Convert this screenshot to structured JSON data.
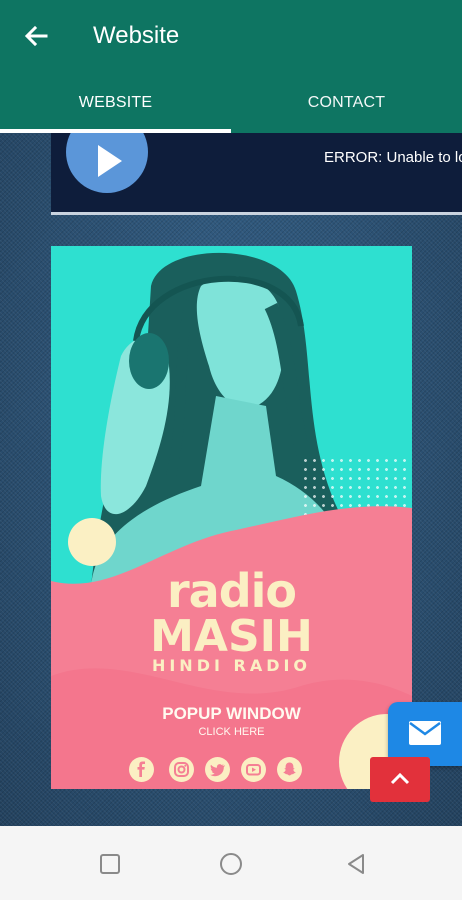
{
  "appbar": {
    "title": "Website",
    "back_icon": "arrow-left-icon"
  },
  "tabs": [
    {
      "label": "WEBSITE",
      "selected": true
    },
    {
      "label": "CONTACT",
      "selected": false
    }
  ],
  "player": {
    "play_icon": "play-icon",
    "status": "ERROR: Unable to lo"
  },
  "poster": {
    "title_line1": "radio",
    "title_line2": "MASIH",
    "subtitle": "HINDI RADIO",
    "cta": "POPUP WINDOW",
    "cta_sub": "CLICK HERE",
    "social_icons": [
      "facebook-icon",
      "instagram-icon",
      "twitter-icon",
      "youtube-icon",
      "snapchat-icon"
    ]
  },
  "floating": {
    "mail_icon": "mail-icon",
    "scroll_top_icon": "chevron-up-icon"
  },
  "navbar": {
    "icons": [
      "recents-square-icon",
      "home-circle-icon",
      "back-triangle-icon"
    ]
  },
  "colors": {
    "appbar": "#0e7562",
    "poster_teal": "#2ee0d0",
    "poster_pink": "#f57f94",
    "cream": "#fbefc3",
    "mail_blue": "#1e88e5",
    "top_red": "#e2313b"
  }
}
